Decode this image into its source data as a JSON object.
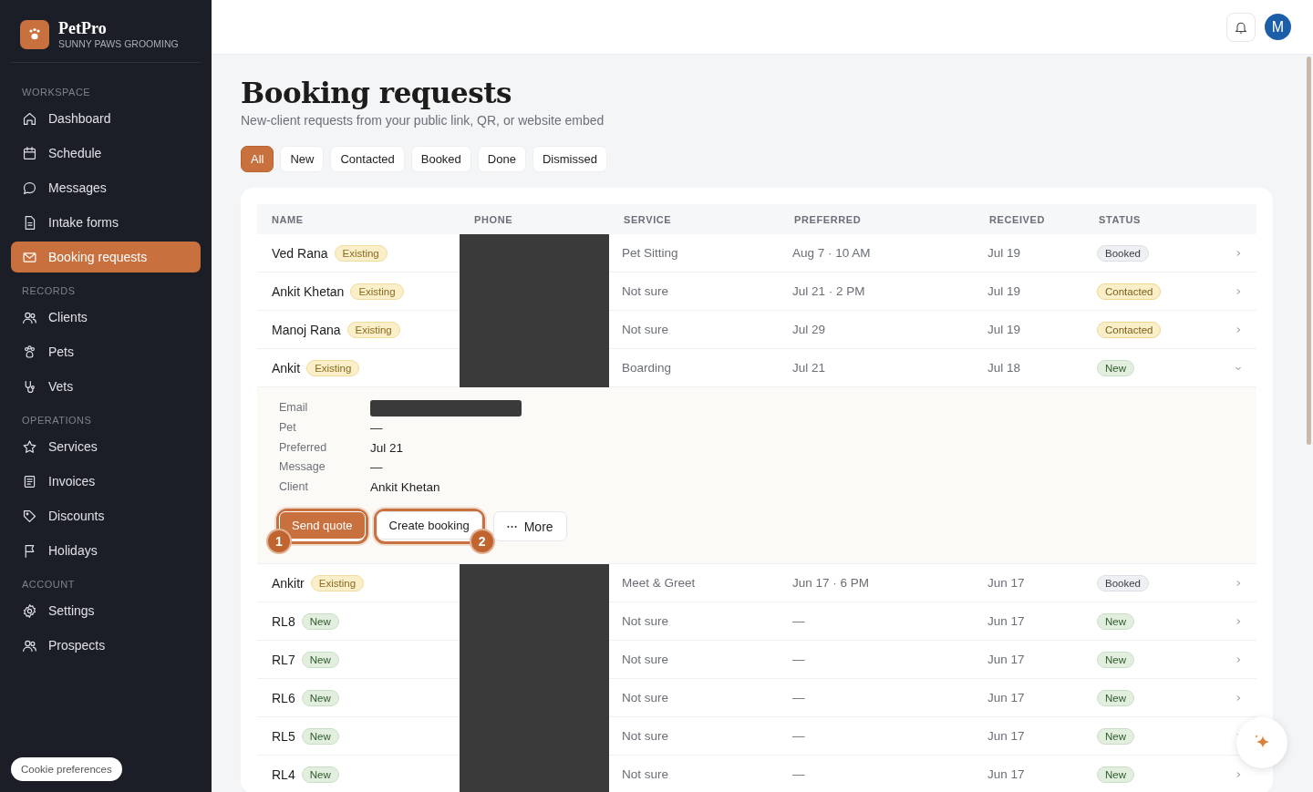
{
  "brand": {
    "name": "PetPro",
    "subtitle": "SUNNY PAWS GROOMING"
  },
  "sidebar": {
    "sections": [
      {
        "label": "WORKSPACE",
        "items": [
          {
            "label": "Dashboard",
            "selected": false
          },
          {
            "label": "Schedule",
            "selected": false
          },
          {
            "label": "Messages",
            "selected": false
          },
          {
            "label": "Intake forms",
            "selected": false
          },
          {
            "label": "Booking requests",
            "selected": true
          }
        ]
      },
      {
        "label": "RECORDS",
        "items": [
          {
            "label": "Clients",
            "selected": false
          },
          {
            "label": "Pets",
            "selected": false
          },
          {
            "label": "Vets",
            "selected": false
          }
        ]
      },
      {
        "label": "OPERATIONS",
        "items": [
          {
            "label": "Services",
            "selected": false
          },
          {
            "label": "Invoices",
            "selected": false
          },
          {
            "label": "Discounts",
            "selected": false
          },
          {
            "label": "Holidays",
            "selected": false
          }
        ]
      },
      {
        "label": "ACCOUNT",
        "items": [
          {
            "label": "Settings",
            "selected": false
          },
          {
            "label": "Prospects",
            "selected": false
          }
        ]
      }
    ],
    "cookie_button": "Cookie preferences"
  },
  "topbar": {
    "avatar": "M"
  },
  "page": {
    "title": "Booking requests",
    "subtitle": "New-client requests from your public link, QR, or website embed"
  },
  "filters": [
    {
      "label": "All",
      "selected": true
    },
    {
      "label": "New",
      "selected": false
    },
    {
      "label": "Contacted",
      "selected": false
    },
    {
      "label": "Booked",
      "selected": false
    },
    {
      "label": "Done",
      "selected": false
    },
    {
      "label": "Dismissed",
      "selected": false
    }
  ],
  "table": {
    "columns": [
      "NAME",
      "PHONE",
      "SERVICE",
      "PREFERRED",
      "RECEIVED",
      "STATUS"
    ],
    "rows": [
      {
        "name": "Ved Rana",
        "tag": {
          "label": "Existing",
          "kind": "existing"
        },
        "phone_redacted": true,
        "service": "Pet Sitting",
        "preferred": "Aug 7 · 10 AM",
        "received": "Jul 19",
        "status": {
          "label": "Booked",
          "kind": "booked"
        },
        "expanded": false
      },
      {
        "name": "Ankit Khetan",
        "tag": {
          "label": "Existing",
          "kind": "existing"
        },
        "phone_redacted": true,
        "service": "Not sure",
        "preferred": "Jul 21 · 2 PM",
        "received": "Jul 19",
        "status": {
          "label": "Contacted",
          "kind": "contacted"
        },
        "expanded": false
      },
      {
        "name": "Manoj Rana",
        "tag": {
          "label": "Existing",
          "kind": "existing"
        },
        "phone_redacted": true,
        "service": "Not sure",
        "preferred": "Jul 29",
        "received": "Jul 19",
        "status": {
          "label": "Contacted",
          "kind": "contacted"
        },
        "expanded": false
      },
      {
        "name": "Ankit",
        "tag": {
          "label": "Existing",
          "kind": "existing"
        },
        "phone_redacted": true,
        "service": "Boarding",
        "preferred": "Jul 21",
        "received": "Jul 18",
        "status": {
          "label": "New",
          "kind": "new"
        },
        "expanded": true,
        "details": [
          {
            "label": "Email",
            "redacted": true
          },
          {
            "label": "Pet",
            "value": "—"
          },
          {
            "label": "Preferred",
            "value": "Jul 21"
          },
          {
            "label": "Message",
            "value": "—"
          },
          {
            "label": "Client",
            "value": "Ankit Khetan"
          }
        ],
        "actions": [
          {
            "label": "Send quote",
            "kind": "primary",
            "step": "1"
          },
          {
            "label": "Create booking",
            "kind": "secondary",
            "step": "2"
          },
          {
            "label": "More",
            "kind": "more"
          }
        ]
      },
      {
        "name": "Ankitr",
        "tag": {
          "label": "Existing",
          "kind": "existing"
        },
        "phone_redacted": true,
        "service": "Meet & Greet",
        "preferred": "Jun 17 · 6 PM",
        "received": "Jun 17",
        "status": {
          "label": "Booked",
          "kind": "booked"
        },
        "expanded": false
      },
      {
        "name": "RL8",
        "tag": {
          "label": "New",
          "kind": "new"
        },
        "phone_redacted": true,
        "service": "Not sure",
        "preferred": "—",
        "received": "Jun 17",
        "status": {
          "label": "New",
          "kind": "new"
        },
        "expanded": false
      },
      {
        "name": "RL7",
        "tag": {
          "label": "New",
          "kind": "new"
        },
        "phone_redacted": true,
        "service": "Not sure",
        "preferred": "—",
        "received": "Jun 17",
        "status": {
          "label": "New",
          "kind": "new"
        },
        "expanded": false
      },
      {
        "name": "RL6",
        "tag": {
          "label": "New",
          "kind": "new"
        },
        "phone_redacted": true,
        "service": "Not sure",
        "preferred": "—",
        "received": "Jun 17",
        "status": {
          "label": "New",
          "kind": "new"
        },
        "expanded": false
      },
      {
        "name": "RL5",
        "tag": {
          "label": "New",
          "kind": "new"
        },
        "phone_redacted": true,
        "service": "Not sure",
        "preferred": "—",
        "received": "Jun 17",
        "status": {
          "label": "New",
          "kind": "new"
        },
        "expanded": false
      },
      {
        "name": "RL4",
        "tag": {
          "label": "New",
          "kind": "new"
        },
        "phone_redacted": true,
        "service": "Not sure",
        "preferred": "—",
        "received": "Jun 17",
        "status": {
          "label": "New",
          "kind": "new"
        },
        "expanded": false
      }
    ]
  }
}
